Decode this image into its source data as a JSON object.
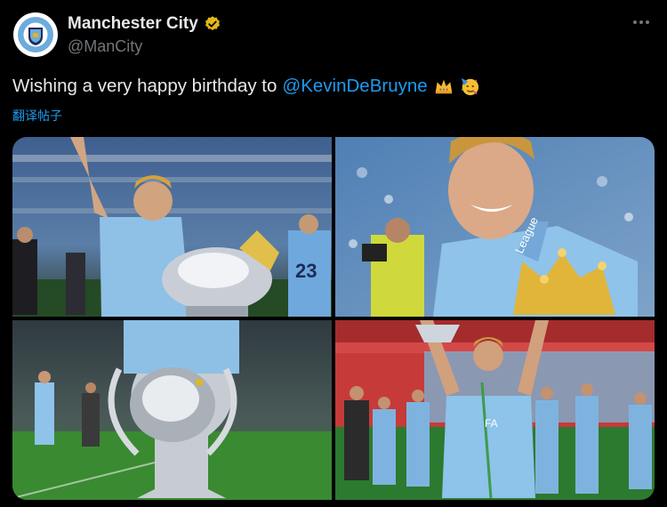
{
  "account": {
    "name": "Manchester City",
    "handle": "@ManCity",
    "logo_text": "MANCHESTER CITY",
    "verified_color": "#e2b719"
  },
  "tweet": {
    "text": "Wishing a very happy birthday to",
    "mention": "@KevinDeBruyne",
    "emojis": [
      "crown-emoji",
      "party-face-emoji"
    ],
    "translate_label": "翻译帖子"
  },
  "photos": [
    {
      "id": "photo-trophy-lift"
    },
    {
      "id": "photo-smile-closeup"
    },
    {
      "id": "photo-champions-league-trophy"
    },
    {
      "id": "photo-fa-cup-celebration"
    }
  ],
  "photo_text": {
    "photo1_shirt_number": "23",
    "photo2_lanyard": "League",
    "photo4_lanyard": "FA"
  },
  "colors": {
    "link": "#1d9bf0",
    "sky_blue": "#7cb7e6",
    "grass": "#2f7a2c"
  }
}
